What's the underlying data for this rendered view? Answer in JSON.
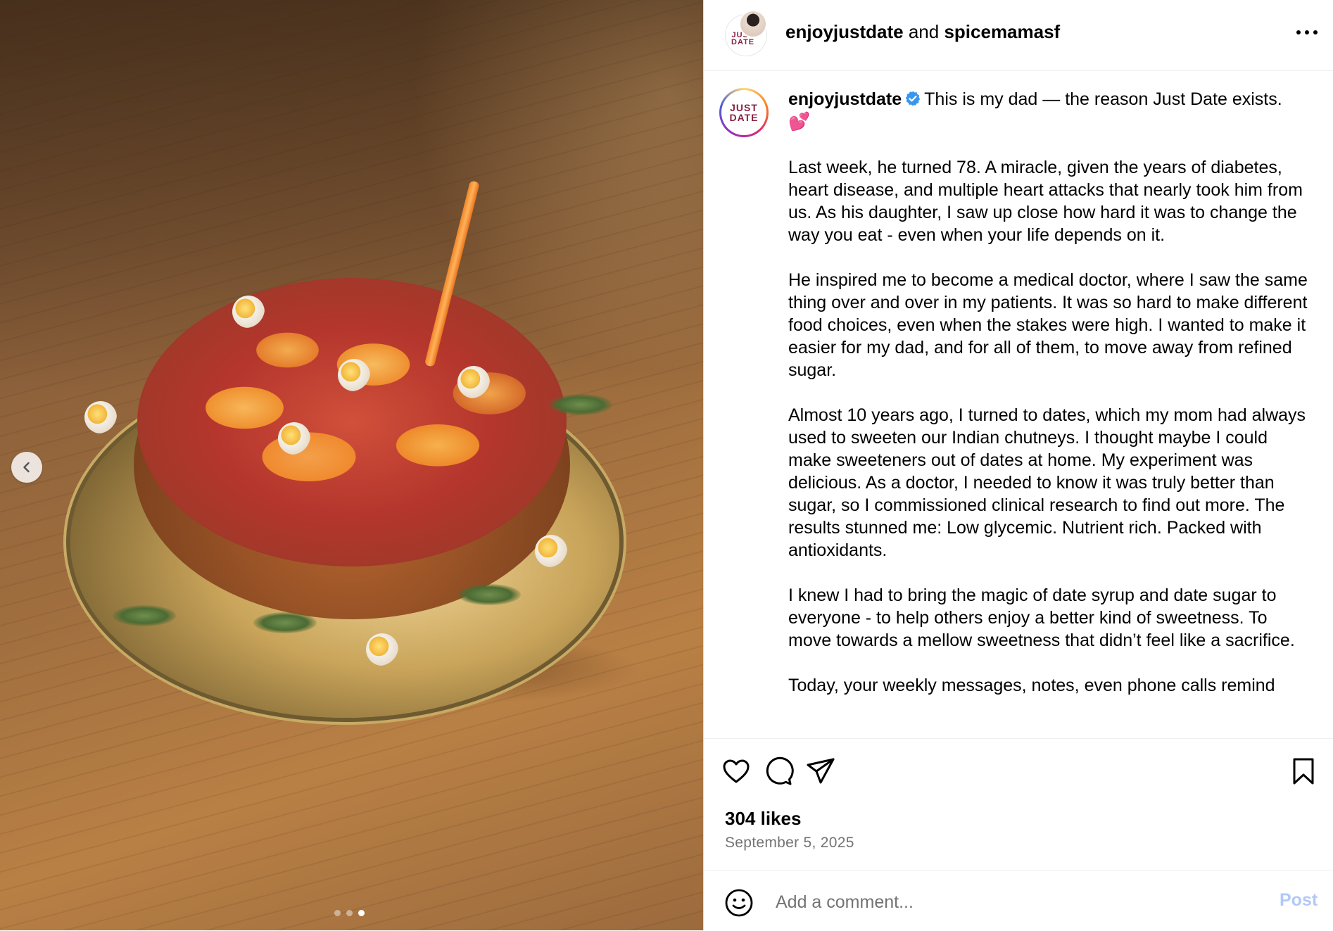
{
  "post": {
    "collab_user": "enjoyjustdate",
    "header_joiner": "and",
    "collab_partner": "spicemamasf",
    "logo_line1": "JUST",
    "logo_line2": "DATE"
  },
  "caption": {
    "username": "enjoyjustdate",
    "intro": "This is my dad — the reason Just Date exists.",
    "intro_emoji": "💕",
    "paragraphs": [
      "Last week, he turned 78. A miracle, given the years of diabetes, heart disease, and multiple heart attacks that nearly took him from us. As his daughter, I saw up close how hard it was to change the way you eat - even when your life depends on it.",
      "He inspired me to become a medical doctor, where I saw the same thing over and over in my patients. It was so hard to make different food choices, even when the stakes were high. I wanted to make it easier for my dad, and for all of them, to move away from refined sugar.",
      "Almost 10 years ago, I turned to dates, which my mom had always used to sweeten our Indian chutneys. I thought maybe I could make sweeteners out of dates at home. My experiment was delicious. As a doctor, I needed to know it was truly better than sugar, so I commissioned clinical research to find out more. The results stunned me: Low glycemic. Nutrient rich. Packed with antioxidants.",
      "I knew I had to bring the magic of date syrup and date sugar to everyone - to help others enjoy a better kind of sweetness. To move towards a mellow sweetness that didn’t feel like a sacrifice.",
      "Today, your weekly messages, notes, even phone calls remind"
    ]
  },
  "engagement": {
    "likes": "304 likes",
    "date": "September 5, 2025"
  },
  "comment": {
    "placeholder": "Add a comment...",
    "post_label": "Post"
  },
  "carousel": {
    "slide_count": 3,
    "active_index": 2
  },
  "icons": {
    "more": "more-options-icon",
    "like": "heart-icon",
    "comment": "comment-icon",
    "share": "share-icon",
    "save": "bookmark-icon",
    "emoji": "emoji-icon",
    "prev": "chevron-left-icon",
    "verified": "verified-badge-icon"
  },
  "colors": {
    "post_button": "#b2c9f7",
    "verified": "#3797f0",
    "secondary_text": "#737373",
    "brand": "#8a2143"
  }
}
